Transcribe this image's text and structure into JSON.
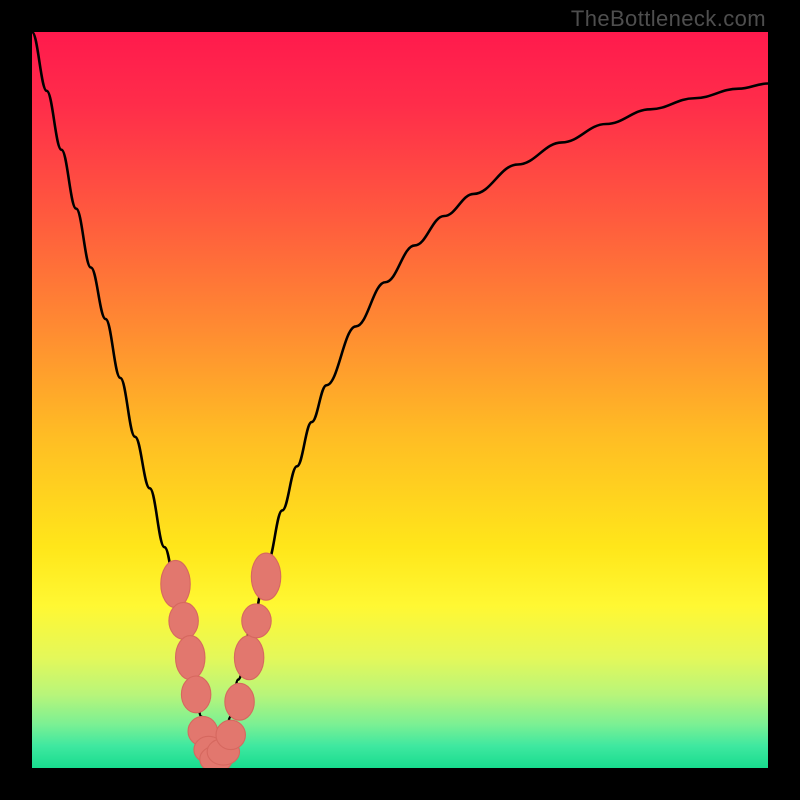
{
  "watermark": "TheBottleneck.com",
  "colors": {
    "frame": "#000000",
    "curve": "#000000",
    "marker_fill": "#e2776e",
    "marker_stroke": "#d6685f",
    "gradient_stops": [
      {
        "offset": 0.0,
        "color": "#ff1a4d"
      },
      {
        "offset": 0.1,
        "color": "#ff2d4a"
      },
      {
        "offset": 0.25,
        "color": "#ff5a3e"
      },
      {
        "offset": 0.4,
        "color": "#ff8a32"
      },
      {
        "offset": 0.55,
        "color": "#ffbd24"
      },
      {
        "offset": 0.7,
        "color": "#ffe61a"
      },
      {
        "offset": 0.78,
        "color": "#fff833"
      },
      {
        "offset": 0.85,
        "color": "#e4f85a"
      },
      {
        "offset": 0.9,
        "color": "#b8f57a"
      },
      {
        "offset": 0.94,
        "color": "#7cf093"
      },
      {
        "offset": 0.97,
        "color": "#3fe8a0"
      },
      {
        "offset": 1.0,
        "color": "#18dc8e"
      }
    ]
  },
  "chart_data": {
    "type": "line",
    "title": "",
    "xlabel": "",
    "ylabel": "",
    "xlim": [
      0,
      100
    ],
    "ylim": [
      0,
      100
    ],
    "x": [
      0,
      2,
      4,
      6,
      8,
      10,
      12,
      14,
      16,
      18,
      20,
      21,
      22,
      23,
      24,
      25,
      26,
      27,
      28,
      30,
      32,
      34,
      36,
      38,
      40,
      44,
      48,
      52,
      56,
      60,
      66,
      72,
      78,
      84,
      90,
      96,
      100
    ],
    "y": [
      100,
      92,
      84,
      76,
      68,
      61,
      53,
      45,
      38,
      30,
      22,
      17,
      12,
      7,
      3,
      1,
      3,
      7,
      12,
      20,
      28,
      35,
      41,
      47,
      52,
      60,
      66,
      71,
      75,
      78,
      82,
      85,
      87.5,
      89.5,
      91,
      92.3,
      93
    ],
    "vertex_x": 25,
    "markers": [
      {
        "x": 19.5,
        "y": 25,
        "rx": 2.0,
        "ry": 3.2
      },
      {
        "x": 20.6,
        "y": 20,
        "rx": 2.0,
        "ry": 2.5
      },
      {
        "x": 21.5,
        "y": 15,
        "rx": 2.0,
        "ry": 3.0
      },
      {
        "x": 22.3,
        "y": 10,
        "rx": 2.0,
        "ry": 2.5
      },
      {
        "x": 23.2,
        "y": 5,
        "rx": 2.0,
        "ry": 2.0
      },
      {
        "x": 24.0,
        "y": 2.5,
        "rx": 2.0,
        "ry": 1.8
      },
      {
        "x": 25.0,
        "y": 1.2,
        "rx": 2.2,
        "ry": 1.8
      },
      {
        "x": 26.0,
        "y": 2.2,
        "rx": 2.2,
        "ry": 1.8
      },
      {
        "x": 27.0,
        "y": 4.5,
        "rx": 2.0,
        "ry": 2.0
      },
      {
        "x": 28.2,
        "y": 9,
        "rx": 2.0,
        "ry": 2.5
      },
      {
        "x": 29.5,
        "y": 15,
        "rx": 2.0,
        "ry": 3.0
      },
      {
        "x": 30.5,
        "y": 20,
        "rx": 2.0,
        "ry": 2.3
      },
      {
        "x": 31.8,
        "y": 26,
        "rx": 2.0,
        "ry": 3.2
      }
    ]
  }
}
